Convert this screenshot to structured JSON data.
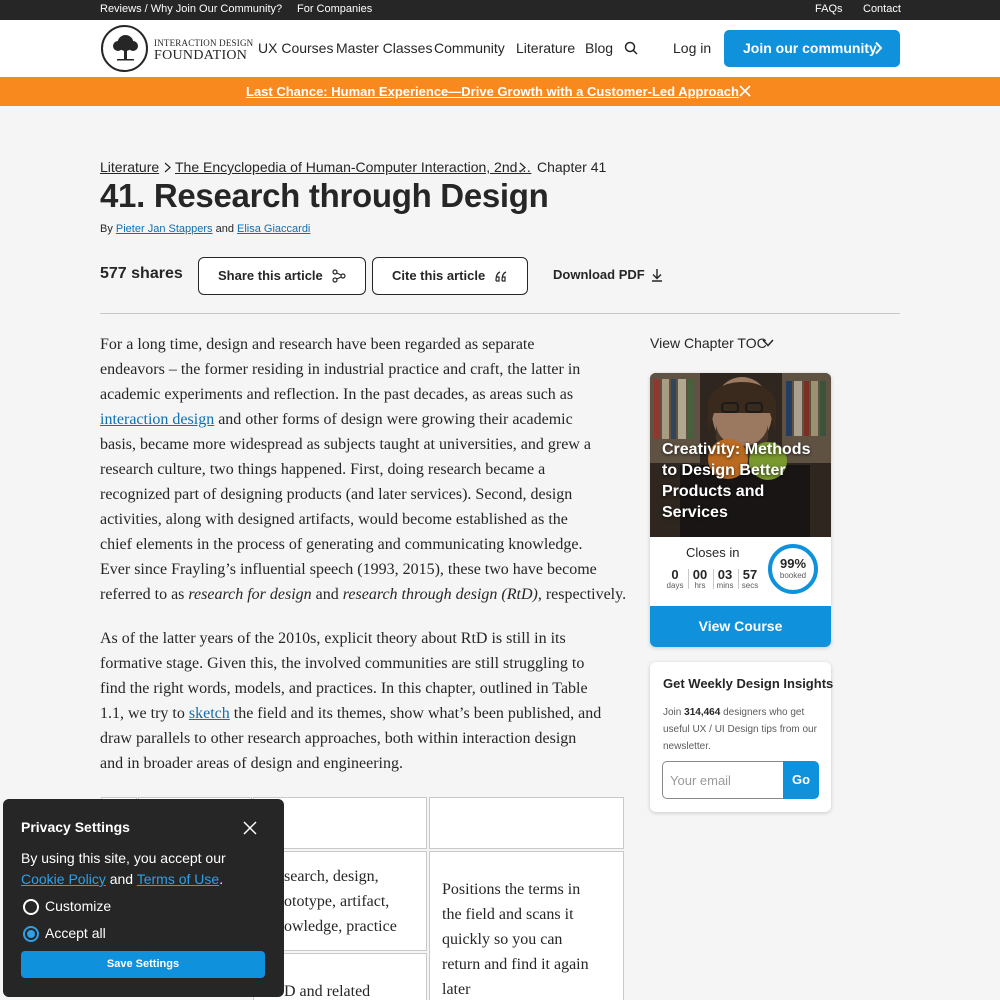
{
  "utility": {
    "reviews": "Reviews / Why Join Our Community?",
    "companies": "For Companies",
    "faqs": "FAQs",
    "contact": "Contact"
  },
  "header": {
    "logo_line1": "INTERACTION DESIGN",
    "logo_line2": "FOUNDATION",
    "nav": [
      "UX Courses",
      "Master Classes",
      "Community",
      "Literature",
      "Blog"
    ],
    "login": "Log in",
    "join": "Join our community"
  },
  "banner": {
    "text": "Last Chance: Human Experience—Drive Growth with a Customer-Led Approach"
  },
  "breadcrumb": {
    "items": [
      "Literature",
      "The Encyclopedia of Human-Computer Interaction, 2nd…",
      "Chapter 41"
    ]
  },
  "article": {
    "title": "41. Research through Design",
    "by": "By",
    "author1": "Pieter Jan Stappers",
    "and": "and",
    "author2": "Elisa Giaccardi",
    "shares": "577 shares",
    "share_label": "Share this article",
    "cite_label": "Cite this article",
    "pdf_label": "Download PDF",
    "p1": [
      "For a long time, design and research have been regarded as separate",
      "endeavors – the former residing in industrial practice and craft, the latter in",
      "academic experiments and reflection. In the past decades, as areas such as",
      "and other forms of design were growing their academic",
      "basis, became more widespread as subjects taught at universities, and grew a",
      "research culture, two things happened. First, doing research became a",
      "recognized part of designing products (and later services). Second, design",
      "activities, along with designed artifacts, would become established as the",
      "chief elements in the process of generating and communicating knowledge.",
      "Ever since Frayling’s influential speech (1993, 2015), these two have become",
      "referred to as"
    ],
    "p1_link": "interaction design",
    "p1_em1": "research for design",
    "p1_and": "and",
    "p1_em2": "research through design (RtD)",
    "p1_tail": ", respectively.",
    "p2": [
      "As of the latter years of the 2010s, explicit theory about RtD is still in its",
      "formative stage. Given this, the involved communities are still struggling to",
      "find the right words, models, and practices. In this chapter, outlined in Table",
      "1.1, we try to",
      "the field and its themes, show what’s been published, and",
      "draw parallels to other research approaches, both within interaction design",
      "and in broader areas of design and engineering."
    ],
    "p2_link": "sketch"
  },
  "table": {
    "c1": [
      "search, design,",
      "ototype, artifact,",
      "owledge, practice"
    ],
    "c2": [
      "Positions the terms in",
      "the field and scans it",
      "quickly so you can",
      "return and find it again",
      "later"
    ],
    "c3": "D and related"
  },
  "sidebar": {
    "toc": "View Chapter TOC",
    "course_title": "Creativity: Methods to Design Better Products and Services",
    "closes_in": "Closes in",
    "countdown": [
      {
        "value": "0",
        "unit": "days"
      },
      {
        "value": "00",
        "unit": "hrs"
      },
      {
        "value": "03",
        "unit": "mins"
      },
      {
        "value": "57",
        "unit": "secs"
      }
    ],
    "booked_pct": "99%",
    "booked_label": "booked",
    "view_course": "View Course",
    "news_title": "Get Weekly Design Insights",
    "news_join": "Join",
    "news_count": "314,464",
    "news_rest": "designers who get useful UX / UI Design tips from our newsletter.",
    "email_placeholder": "Your email",
    "go": "Go"
  },
  "privacy": {
    "title": "Privacy Settings",
    "text_start": "By using this site, you accept our",
    "cookie_link": "Cookie Policy",
    "and": "and",
    "terms_link": "Terms of Use",
    "period": ".",
    "customize": "Customize",
    "accept_all": "Accept all",
    "save": "Save Settings"
  },
  "colors": {
    "accent": "#0f91dc",
    "banner": "#f7891f",
    "dark": "#262626"
  }
}
